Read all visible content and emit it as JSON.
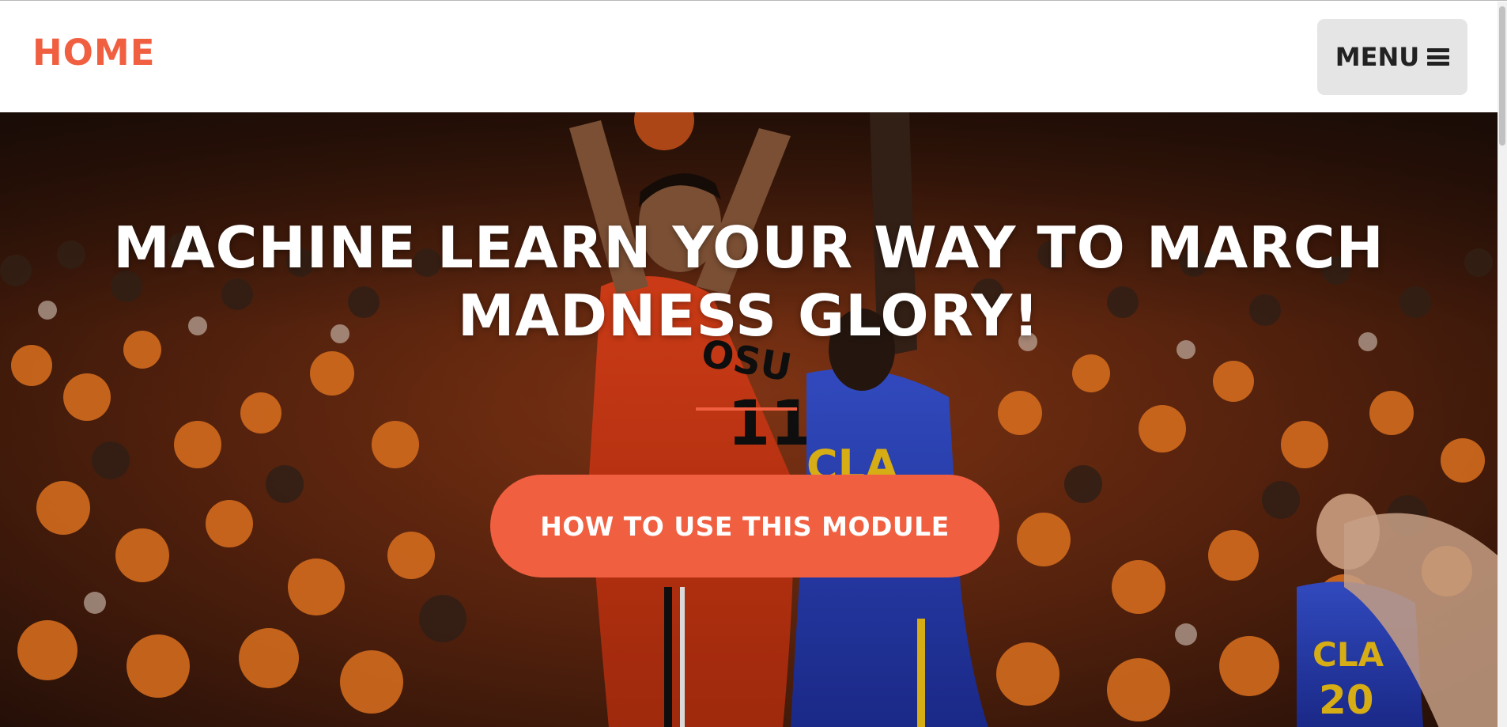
{
  "navbar": {
    "brand": "HOME",
    "menu_label": "MENU",
    "menu_icon": "bars-icon"
  },
  "hero": {
    "title_line1": "MACHINE LEARN YOUR WAY TO MARCH",
    "title_line2": "MADNESS GLORY!",
    "cta_label": "HOW TO USE THIS MODULE",
    "background": "basketball-game-photo",
    "player_jersey_number_1": "11",
    "player_jersey_number_2": "20",
    "jersey_text_1": "OSU",
    "jersey_text_2": "UCLA"
  },
  "colors": {
    "accent": "#f05f40",
    "menu_bg": "#e5e5e5",
    "text_dark": "#222222",
    "white": "#ffffff"
  }
}
